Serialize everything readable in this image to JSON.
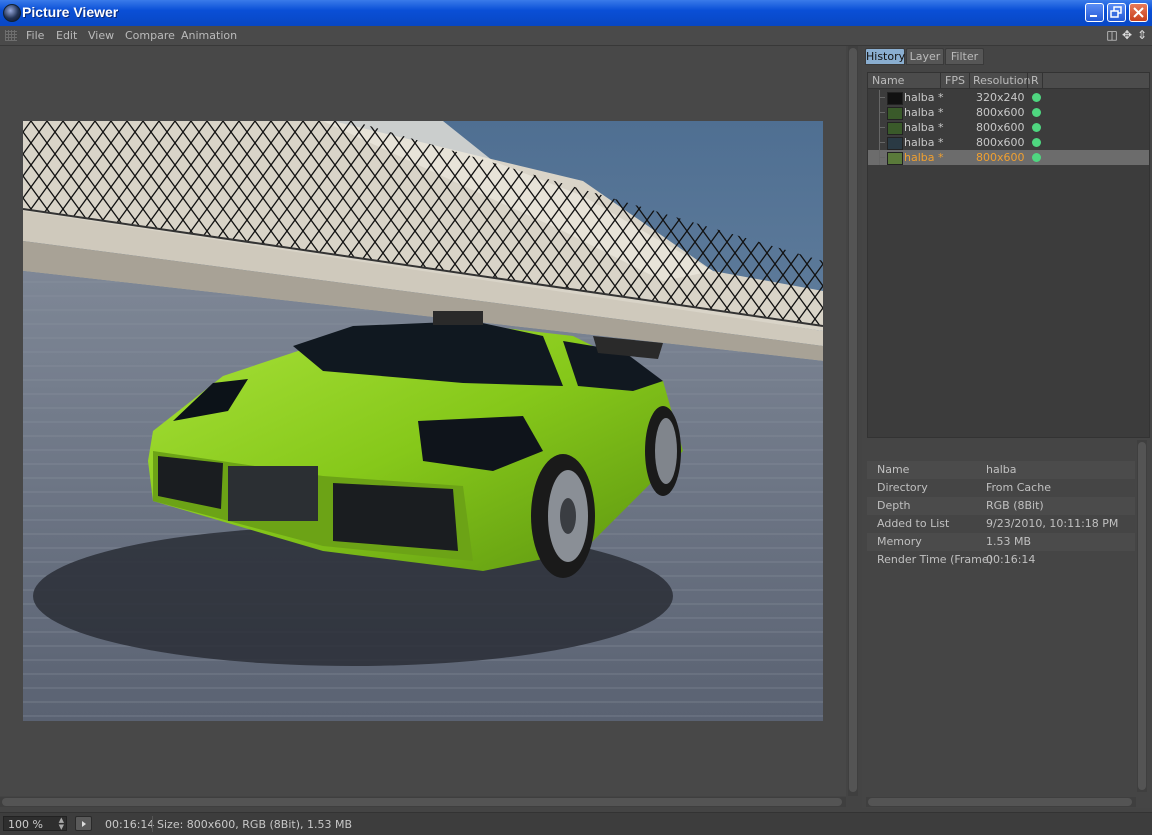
{
  "window": {
    "title": "Picture Viewer",
    "controls": [
      "minimize-icon",
      "restore-icon",
      "close-icon"
    ]
  },
  "menu": {
    "items": [
      "File",
      "Edit",
      "View",
      "Compare",
      "Animation"
    ],
    "right_icons": [
      "panel-toggle-icon",
      "move-icon",
      "sort-icon"
    ]
  },
  "tabs": [
    {
      "label": "History",
      "active": true
    },
    {
      "label": "Layer",
      "active": false
    },
    {
      "label": "Filter",
      "active": false
    }
  ],
  "history": {
    "columns": [
      "Name",
      "FPS",
      "Resolution",
      "R"
    ],
    "rows": [
      {
        "name": "halba *",
        "fps": "",
        "resolution": "320x240",
        "selected": false
      },
      {
        "name": "halba *",
        "fps": "",
        "resolution": "800x600",
        "selected": false
      },
      {
        "name": "halba *",
        "fps": "",
        "resolution": "800x600",
        "selected": false
      },
      {
        "name": "halba *",
        "fps": "",
        "resolution": "800x600",
        "selected": false
      },
      {
        "name": "halba *",
        "fps": "",
        "resolution": "800x600",
        "selected": true
      }
    ],
    "status_color": "#4fd680",
    "selected_text_color": "#f0a030"
  },
  "info": [
    {
      "key": "Name",
      "value": "halba"
    },
    {
      "key": "Directory",
      "value": "From Cache"
    },
    {
      "key": "Depth",
      "value": "RGB (8Bit)"
    },
    {
      "key": "Added to List",
      "value": "9/23/2010, 10:11:18 PM"
    },
    {
      "key": "Memory",
      "value": "1.53 MB"
    },
    {
      "key": "Render Time (Frame)",
      "value": "00:16:14"
    }
  ],
  "status": {
    "zoom": "100 %",
    "time": "00:16:14",
    "info": "Size: 800x600, RGB (8Bit), 1.53 MB"
  },
  "render": {
    "subject": "green-sports-car-render",
    "car_color": "#8ed21e",
    "sky_color": "#5c7896"
  }
}
